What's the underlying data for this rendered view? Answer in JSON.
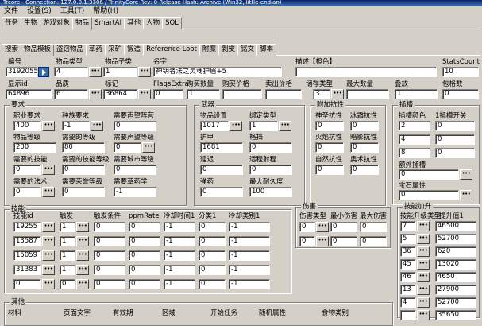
{
  "title": "Trcore - Connection: 127.0.0.1:3306 / TrinityCore Rev: 0 Release Hash: Archive (Win32, little-endian)",
  "menu": [
    "文件",
    "设置(S)",
    "工具(T)",
    "帮助(H)"
  ],
  "main_tabs": [
    "任务",
    "生物",
    "游戏对象",
    "物品",
    "SmartAI",
    "其他",
    "人物",
    "SQL"
  ],
  "sub_tabs": [
    "搜索",
    "物品模板",
    "盗窃物品",
    "草药",
    "采矿",
    "锻造",
    "Reference Loot",
    "附魔",
    "剥皮",
    "铭文",
    "脚本"
  ],
  "top": {
    "entry_label": "编号",
    "entry": "3192055",
    "class_label": "物品类型",
    "class": "4",
    "subclass_label": "物品子类",
    "subclass": "1",
    "name_label": "名字",
    "name": "神钥者法之灵魂护眉+5",
    "desc_label": "描述【橙色】",
    "desc": "",
    "stats_label": "StatsCount",
    "stats": "10",
    "display_label": "显示id",
    "display": "64896",
    "quality_label": "品质",
    "quality": "6",
    "flags_label": "标记",
    "flags": "36864",
    "flagsextra_label": "FlagsExtra",
    "flagsextra": "0",
    "buycount_label": "购买数量",
    "buycount": "1",
    "buyprice_label": "购买价格",
    "buyprice": "",
    "sellprice_label": "卖出价格",
    "sellprice": "",
    "inv_label": "储存类型",
    "inv": "3",
    "maxcount_label": "最大数量",
    "maxcount": "",
    "stack_label": "叠放",
    "stack": "1",
    "bag_label": "包格数",
    "bag": "0"
  },
  "req": {
    "title": "要求",
    "class_label": "职业要求",
    "class": "400",
    "race_label": "种族要求",
    "race": "-1",
    "rep_label": "需要声望阵营",
    "rep": "0",
    "ilevel_label": "物品等级",
    "ilevel": "200",
    "level_label": "需要的等级",
    "level": "80",
    "replevel_label": "需要声望等级",
    "replevel": "0",
    "skill_label": "需要的技能",
    "skill": "0",
    "skillrank_label": "需要的技能等级",
    "skillrank": "0",
    "city_label": "需要城市等级",
    "city": "0",
    "spell_label": "需要的法术",
    "spell": "0",
    "honor_label": "需要荣誉等级",
    "honor": "0",
    "herb_label": "需要草药学",
    "herb": "-1"
  },
  "weapon": {
    "title": "武器",
    "set_label": "物品设置",
    "set": "1017",
    "bind_label": "绑定类型",
    "bind": "1",
    "armor_label": "护甲",
    "armor": "1681",
    "block_label": "格挡",
    "block": "0",
    "delay_label": "延迟",
    "delay": "0",
    "range_label": "远程射程",
    "range": "0",
    "ammo_label": "弹药",
    "ammo": "0",
    "dur_label": "最大耐久度",
    "dur": "100"
  },
  "res": {
    "title": "附加抗性",
    "holy_label": "神圣抗性",
    "holy": "0",
    "frost_label": "冰霜抗性",
    "frost": "0",
    "fire_label": "火焰抗性",
    "fire": "0",
    "shadow_label": "暗影抗性",
    "shadow": "0",
    "nature_label": "自然抗性",
    "nature": "0",
    "arcane_label": "奥术抗性",
    "arcane": "0"
  },
  "socket": {
    "title": "插槽",
    "color_label": "插槽颜色",
    "switch_label": "1插槽开关",
    "colors": [
      "2",
      "4",
      "8"
    ],
    "switches": [
      "0",
      "0",
      "0"
    ],
    "extra_label": "额外插槽",
    "extra": "0",
    "gem_label": "宝石属性",
    "gem": "0"
  },
  "spells": {
    "title": "技能",
    "cols": [
      "技能id",
      "触发",
      "触发条件",
      "ppmRate",
      "冷却时间1",
      "分类1",
      "冷却类别1"
    ],
    "rows": [
      [
        "19255",
        "1",
        "0",
        "0",
        "-1",
        "0",
        "-1"
      ],
      [
        "13587",
        "1",
        "0",
        "0",
        "-1",
        "0",
        "-1"
      ],
      [
        "15059",
        "1",
        "0",
        "0",
        "-1",
        "0",
        "-1"
      ],
      [
        "31383",
        "1",
        "0",
        "0",
        "-1",
        "0",
        "-1"
      ],
      [
        "0",
        "0",
        "0",
        "0",
        "-1",
        "0",
        "-1"
      ]
    ]
  },
  "damage": {
    "title": "伤害",
    "type_label": "伤害类型",
    "min_label": "最小伤害",
    "max_label": "最大伤害",
    "rows": [
      [
        "0",
        "0",
        "0"
      ],
      [
        "0",
        "0",
        "0"
      ]
    ]
  },
  "skillup": {
    "title": "技能加升",
    "type_label": "技能升级类型",
    "value_label": "提升值1",
    "rows": [
      [
        "7",
        "46500"
      ],
      [
        "5",
        "52700"
      ],
      [
        "36",
        "620"
      ],
      [
        "45",
        "13020"
      ],
      [
        "46",
        "4650"
      ],
      [
        "13",
        "27900"
      ],
      [
        "4",
        "52700"
      ],
      [
        "",
        "35650"
      ]
    ]
  },
  "other": {
    "title": "其他",
    "cols": [
      "材料",
      "页面文字",
      "有效期",
      "区域",
      "开始任务",
      "随机属性",
      "食物类别"
    ]
  }
}
